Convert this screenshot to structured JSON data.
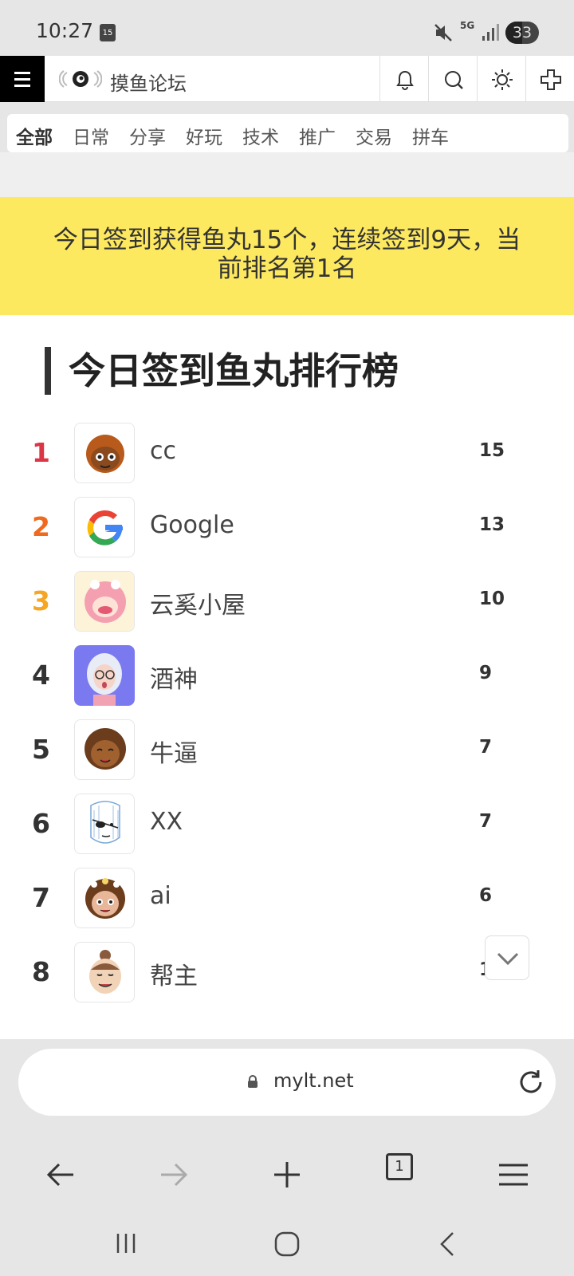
{
  "status_bar": {
    "time": "10:27",
    "calendar_day": "15",
    "network": "5G",
    "battery": "33"
  },
  "header": {
    "site_title": "摸鱼论坛"
  },
  "categories": [
    {
      "label": "全部",
      "active": true
    },
    {
      "label": "日常",
      "active": false
    },
    {
      "label": "分享",
      "active": false
    },
    {
      "label": "好玩",
      "active": false
    },
    {
      "label": "技术",
      "active": false
    },
    {
      "label": "推广",
      "active": false
    },
    {
      "label": "交易",
      "active": false
    },
    {
      "label": "拼车",
      "active": false
    }
  ],
  "banner": {
    "line1": "今日签到获得鱼丸15个，连续签到9天，当",
    "line2": "前排名第1名"
  },
  "leaderboard": {
    "title": "今日签到鱼丸排行榜",
    "rows": [
      {
        "rank": "1",
        "name": "cc",
        "score": "15"
      },
      {
        "rank": "2",
        "name": "Google",
        "score": "13"
      },
      {
        "rank": "3",
        "name": "云奚小屋",
        "score": "10"
      },
      {
        "rank": "4",
        "name": "酒神",
        "score": "9"
      },
      {
        "rank": "5",
        "name": "牛逼",
        "score": "7"
      },
      {
        "rank": "6",
        "name": "XX",
        "score": "7"
      },
      {
        "rank": "7",
        "name": "ai",
        "score": "6"
      },
      {
        "rank": "8",
        "name": "帮主",
        "score": "1"
      }
    ]
  },
  "browser": {
    "url": "mylt.net",
    "tab_count": "1"
  },
  "colors": {
    "banner_bg": "#fde95f",
    "rank1": "#dc3545",
    "rank2": "#f06a1d",
    "rank3": "#f5a623"
  }
}
